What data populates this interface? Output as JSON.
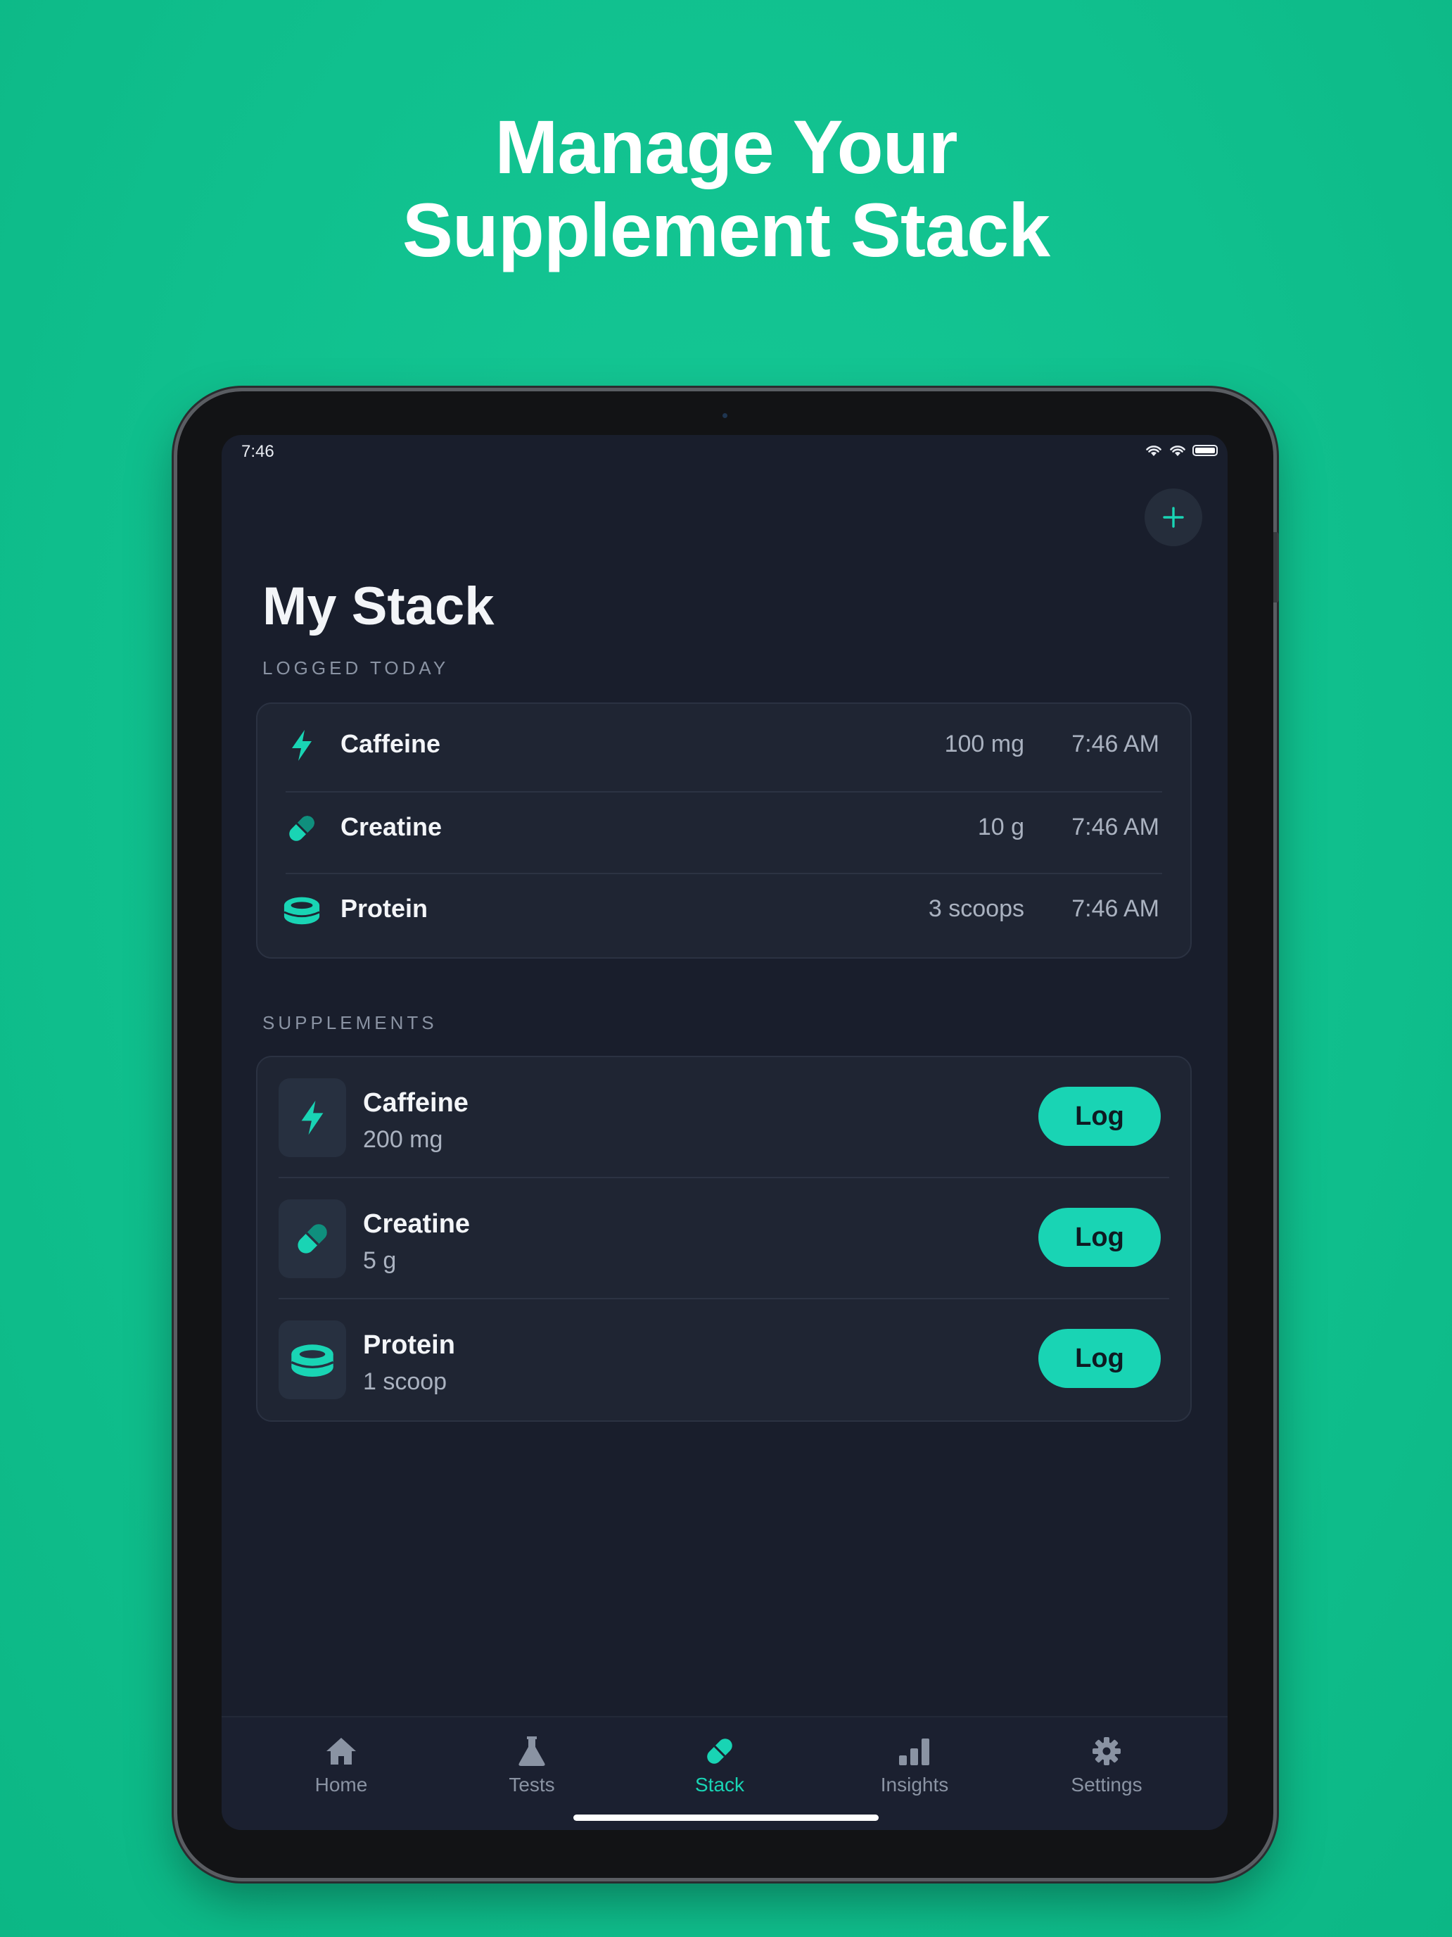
{
  "headline": {
    "line1": "Manage Your",
    "line2": "Supplement Stack"
  },
  "status_bar": {
    "time": "7:46"
  },
  "page": {
    "title": "My Stack"
  },
  "logged_today": {
    "label": "LOGGED TODAY",
    "items": [
      {
        "name": "Caffeine",
        "amount": "100 mg",
        "time": "7:46 AM",
        "icon": "bolt-icon"
      },
      {
        "name": "Creatine",
        "amount": "10 g",
        "time": "7:46 AM",
        "icon": "capsule-icon"
      },
      {
        "name": "Protein",
        "amount": "3 scoops",
        "time": "7:46 AM",
        "icon": "protein-tub-icon"
      }
    ]
  },
  "supplements": {
    "label": "SUPPLEMENTS",
    "log_label": "Log",
    "items": [
      {
        "name": "Caffeine",
        "dose": "200 mg",
        "icon": "bolt-icon"
      },
      {
        "name": "Creatine",
        "dose": "5 g",
        "icon": "capsule-icon"
      },
      {
        "name": "Protein",
        "dose": "1 scoop",
        "icon": "protein-tub-icon"
      }
    ]
  },
  "tabs": [
    {
      "label": "Home",
      "icon": "home-icon",
      "active": false
    },
    {
      "label": "Tests",
      "icon": "flask-icon",
      "active": false
    },
    {
      "label": "Stack",
      "icon": "capsule-icon",
      "active": true
    },
    {
      "label": "Insights",
      "icon": "bar-chart-icon",
      "active": false
    },
    {
      "label": "Settings",
      "icon": "gear-icon",
      "active": false
    }
  ],
  "colors": {
    "background": "#10c08e",
    "screen": "#191e2c",
    "card": "#1f2533",
    "accent": "#19d4b4",
    "muted_text": "#8a93a3"
  }
}
